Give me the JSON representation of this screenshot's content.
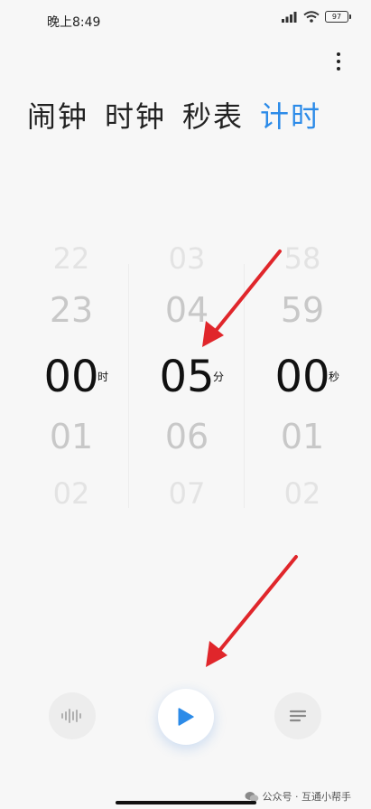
{
  "status_bar": {
    "time": "晚上8:49",
    "battery": "97"
  },
  "tabs": [
    {
      "label": "闹钟",
      "active": false
    },
    {
      "label": "时钟",
      "active": false
    },
    {
      "label": "秒表",
      "active": false
    },
    {
      "label": "计时",
      "active": true
    }
  ],
  "picker": {
    "hours": {
      "values": [
        "22",
        "23",
        "00",
        "01",
        "02"
      ],
      "selected": "00",
      "unit": "时"
    },
    "minutes": {
      "values": [
        "03",
        "04",
        "05",
        "06",
        "07"
      ],
      "selected": "05",
      "unit": "分"
    },
    "seconds": {
      "values": [
        "58",
        "59",
        "00",
        "01",
        "02"
      ],
      "selected": "00",
      "unit": "秒"
    }
  },
  "controls": {
    "left_icon": "waveform-icon",
    "center_icon": "play-icon",
    "right_icon": "list-icon"
  },
  "colors": {
    "accent": "#2c8be8",
    "arrow": "#e0262b"
  },
  "watermark": "公众号 · 互通小帮手"
}
